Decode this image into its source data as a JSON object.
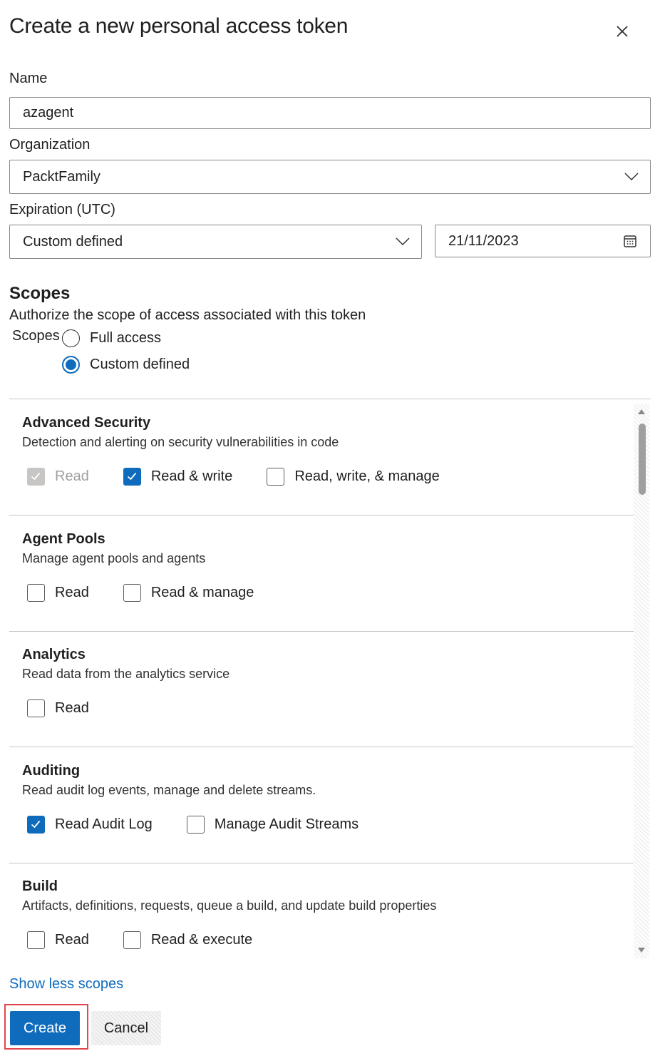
{
  "dialog": {
    "title": "Create a new personal access token"
  },
  "form": {
    "name_label": "Name",
    "name_value": "azagent",
    "org_label": "Organization",
    "org_value": "PacktFamily",
    "expiration_label": "Expiration (UTC)",
    "expiration_value": "Custom defined",
    "date_value": "21/11/2023"
  },
  "scopes": {
    "heading": "Scopes",
    "description": "Authorize the scope of access associated with this token",
    "radio_label": "Scopes",
    "full_access": "Full access",
    "custom_defined": "Custom defined",
    "selected": "Custom defined",
    "groups": [
      {
        "name": "Advanced Security",
        "description": "Detection and alerting on security vulnerabilities in code",
        "options": [
          {
            "label": "Read",
            "checked": true,
            "disabled": true
          },
          {
            "label": "Read & write",
            "checked": true,
            "disabled": false
          },
          {
            "label": "Read, write, & manage",
            "checked": false,
            "disabled": false
          }
        ]
      },
      {
        "name": "Agent Pools",
        "description": "Manage agent pools and agents",
        "options": [
          {
            "label": "Read",
            "checked": false,
            "disabled": false
          },
          {
            "label": "Read & manage",
            "checked": false,
            "disabled": false
          }
        ]
      },
      {
        "name": "Analytics",
        "description": "Read data from the analytics service",
        "options": [
          {
            "label": "Read",
            "checked": false,
            "disabled": false
          }
        ]
      },
      {
        "name": "Auditing",
        "description": "Read audit log events, manage and delete streams.",
        "options": [
          {
            "label": "Read Audit Log",
            "checked": true,
            "disabled": false
          },
          {
            "label": "Manage Audit Streams",
            "checked": false,
            "disabled": false
          }
        ]
      },
      {
        "name": "Build",
        "description": "Artifacts, definitions, requests, queue a build, and update build properties",
        "options": [
          {
            "label": "Read",
            "checked": false,
            "disabled": false
          },
          {
            "label": "Read & execute",
            "checked": false,
            "disabled": false
          }
        ]
      }
    ],
    "toggle_link": "Show less scopes"
  },
  "actions": {
    "create": "Create",
    "cancel": "Cancel"
  },
  "colors": {
    "accent": "#0f6cbd",
    "highlight": "#e0474c"
  },
  "icons": {
    "close": "close-icon",
    "dropdown": "chevron-down-icon",
    "calendar": "calendar-icon",
    "check": "checkmark-icon"
  }
}
